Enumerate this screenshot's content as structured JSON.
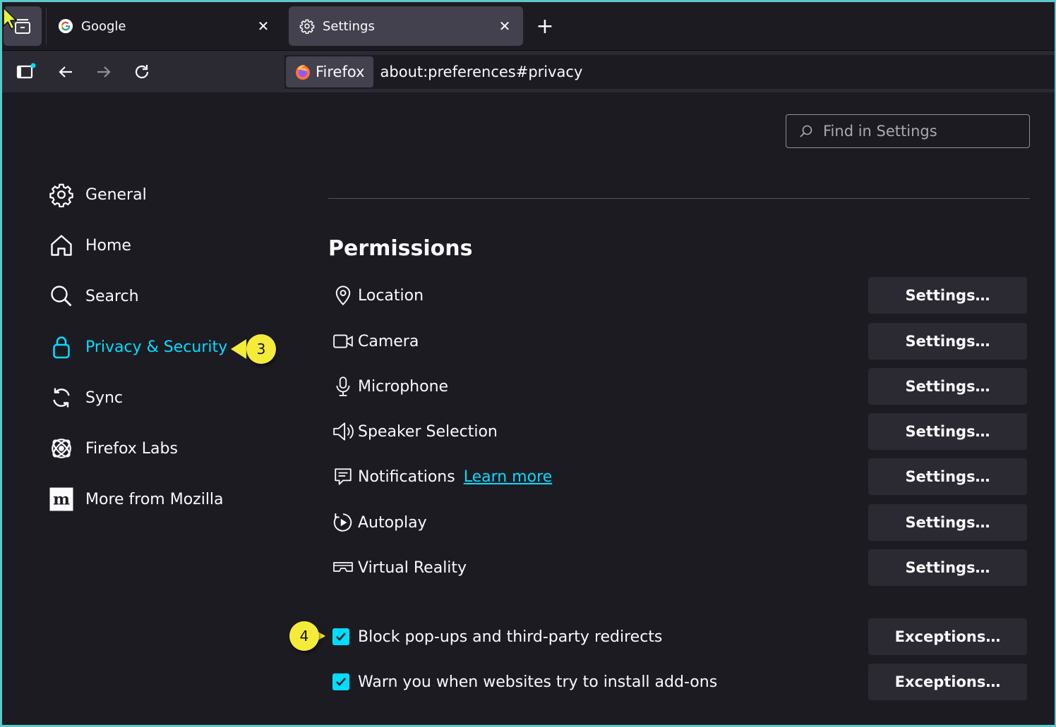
{
  "tabs": [
    {
      "title": "Google",
      "active": false
    },
    {
      "title": "Settings",
      "active": true
    }
  ],
  "urlbar": {
    "identity_label": "Firefox",
    "url": "about:preferences#privacy"
  },
  "search": {
    "placeholder": "Find in Settings"
  },
  "sidebar": {
    "items": [
      {
        "label": "General",
        "icon": "gear-icon"
      },
      {
        "label": "Home",
        "icon": "home-icon"
      },
      {
        "label": "Search",
        "icon": "search-icon"
      },
      {
        "label": "Privacy & Security",
        "icon": "lock-icon",
        "selected": true
      },
      {
        "label": "Sync",
        "icon": "sync-icon"
      },
      {
        "label": "Firefox Labs",
        "icon": "labs-icon"
      },
      {
        "label": "More from Mozilla",
        "icon": "mozilla-icon"
      }
    ]
  },
  "callouts": {
    "step3": "3",
    "step4": "4"
  },
  "permissions": {
    "title": "Permissions",
    "items": [
      {
        "label": "Location",
        "button": "Settings…",
        "icon": "location-pin-icon"
      },
      {
        "label": "Camera",
        "button": "Settings…",
        "icon": "camera-icon"
      },
      {
        "label": "Microphone",
        "button": "Settings…",
        "icon": "microphone-icon"
      },
      {
        "label": "Speaker Selection",
        "button": "Settings…",
        "icon": "speaker-icon"
      },
      {
        "label": "Notifications",
        "button": "Settings…",
        "icon": "notification-icon",
        "link": "Learn more"
      },
      {
        "label": "Autoplay",
        "button": "Settings…",
        "icon": "autoplay-icon"
      },
      {
        "label": "Virtual Reality",
        "button": "Settings…",
        "icon": "vr-headset-icon"
      }
    ],
    "checks": [
      {
        "label": "Block pop-ups and third-party redirects",
        "checked": true,
        "button": "Exceptions…"
      },
      {
        "label": "Warn you when websites try to install add-ons",
        "checked": true,
        "button": "Exceptions…"
      }
    ]
  },
  "colors": {
    "accent": "#00ddff",
    "background": "#1c1b22",
    "callout": "#f5ec3a",
    "frame": "#5ec8c8"
  }
}
